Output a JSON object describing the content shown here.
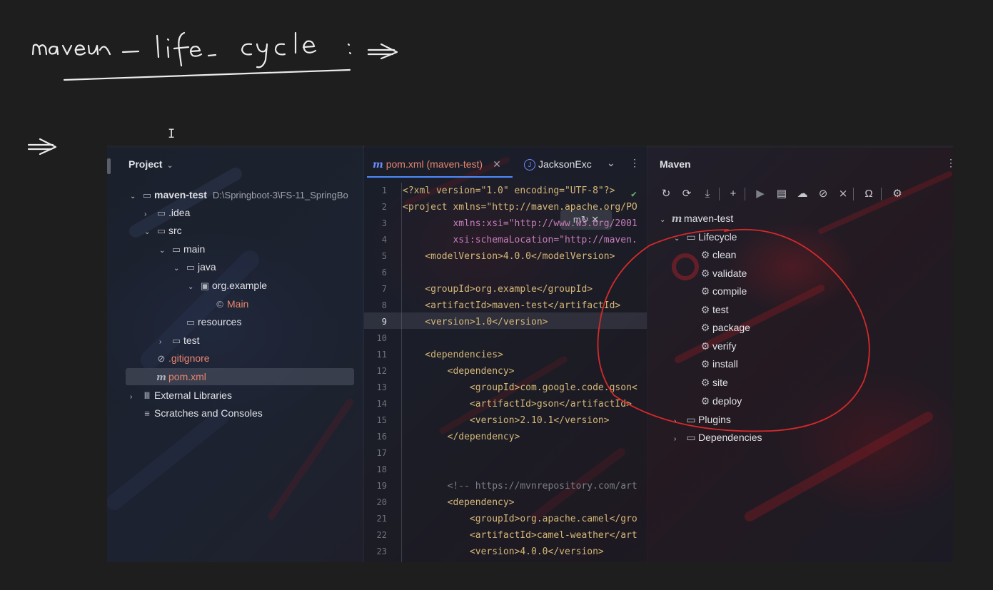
{
  "ide": {
    "project_panel": {
      "title": "Project",
      "tree": [
        {
          "label": "maven-test",
          "path": "D:\\Springboot-3\\FS-11_SpringBo",
          "icon": "module-folder-icon",
          "arrow": "⌄"
        },
        {
          "label": ".idea",
          "icon": "folder-icon",
          "arrow": "›"
        },
        {
          "label": "src",
          "icon": "folder-icon",
          "arrow": "⌄"
        },
        {
          "label": "main",
          "icon": "folder-icon",
          "arrow": "⌄"
        },
        {
          "label": "java",
          "icon": "source-folder-icon",
          "arrow": "⌄"
        },
        {
          "label": "org.example",
          "icon": "package-icon",
          "arrow": "⌄"
        },
        {
          "label": "Main",
          "icon": "class-icon",
          "arrow": ""
        },
        {
          "label": "resources",
          "icon": "resources-folder-icon",
          "arrow": ""
        },
        {
          "label": "test",
          "icon": "folder-icon",
          "arrow": "›"
        },
        {
          "label": ".gitignore",
          "icon": "ignore-file-icon",
          "arrow": ""
        },
        {
          "label": "pom.xml",
          "icon": "maven-file-icon",
          "arrow": ""
        },
        {
          "label": "External Libraries",
          "icon": "libraries-icon",
          "arrow": "›"
        },
        {
          "label": "Scratches and Consoles",
          "icon": "scratches-icon",
          "arrow": ""
        }
      ]
    },
    "editor": {
      "tabs": [
        {
          "label": "pom.xml (maven-test)",
          "active": true
        },
        {
          "label": "JacksonExc"
        }
      ],
      "lines": [
        {
          "n": "1",
          "text": "<?xml version=\"1.0\" encoding=\"UTF-8\"?>"
        },
        {
          "n": "2",
          "text": "<project xmlns=\"http://maven.apache.org/PO"
        },
        {
          "n": "3",
          "text": "         xmlns:xsi=\"http://www.w3.org/2001"
        },
        {
          "n": "4",
          "text": "         xsi:schemaLocation=\"http://maven."
        },
        {
          "n": "5",
          "text": "    <modelVersion>4.0.0</modelVersion>"
        },
        {
          "n": "6",
          "text": ""
        },
        {
          "n": "7",
          "text": "    <groupId>org.example</groupId>"
        },
        {
          "n": "8",
          "text": "    <artifactId>maven-test</artifactId>"
        },
        {
          "n": "9",
          "text": "    <version>1.0</version>"
        },
        {
          "n": "10",
          "text": ""
        },
        {
          "n": "11",
          "text": "    <dependencies>"
        },
        {
          "n": "12",
          "text": "        <dependency>"
        },
        {
          "n": "13",
          "text": "            <groupId>com.google.code.gson<"
        },
        {
          "n": "14",
          "text": "            <artifactId>gson</artifactId>"
        },
        {
          "n": "15",
          "text": "            <version>2.10.1</version>"
        },
        {
          "n": "16",
          "text": "        </dependency>"
        },
        {
          "n": "17",
          "text": ""
        },
        {
          "n": "18",
          "text": ""
        },
        {
          "n": "19",
          "text": "        <!-- https://mvnrepository.com/art"
        },
        {
          "n": "20",
          "text": "        <dependency>"
        },
        {
          "n": "21",
          "text": "            <groupId>org.apache.camel</gro"
        },
        {
          "n": "22",
          "text": "            <artifactId>camel-weather</art"
        },
        {
          "n": "23",
          "text": "            <version>4.0.0</version>"
        }
      ]
    },
    "maven_panel": {
      "title": "Maven",
      "root": "maven-test",
      "lifecycle_label": "Lifecycle",
      "phases": [
        "clean",
        "validate",
        "compile",
        "test",
        "package",
        "verify",
        "install",
        "site",
        "deploy"
      ],
      "plugins_label": "Plugins",
      "dependencies_label": "Dependencies",
      "toolbar_icons": [
        "reload-icon",
        "reload-folder-icon",
        "download-icon",
        "add-icon",
        "run-icon",
        "execute-goal-icon",
        "offline-icon",
        "skip-tests-icon",
        "collapse-icon",
        "analyze-icon",
        "settings-icon"
      ]
    }
  },
  "colors": {
    "annotation_circle": "#d42a2a",
    "accent": "#4e8cff",
    "file_modified": "#e8856e"
  }
}
